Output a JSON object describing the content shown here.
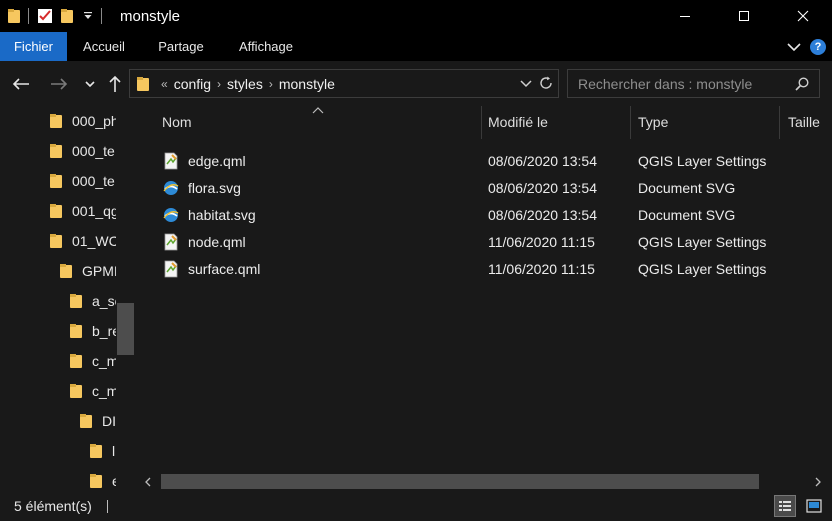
{
  "window": {
    "title": "monstyle",
    "colors": {
      "folder": "#f6c75f",
      "accent": "#1a6ac7",
      "background": "#191919",
      "titlebar": "#000000"
    }
  },
  "ribbon": {
    "tabs": [
      {
        "label": "Fichier",
        "active": true
      },
      {
        "label": "Accueil",
        "active": false
      },
      {
        "label": "Partage",
        "active": false
      },
      {
        "label": "Affichage",
        "active": false
      }
    ]
  },
  "address": {
    "overflow": "«",
    "crumbs": [
      "config",
      "styles",
      "monstyle"
    ]
  },
  "search": {
    "placeholder": "Rechercher dans : monstyle"
  },
  "tree": {
    "items": [
      {
        "label": "000_ph"
      },
      {
        "label": "000_te"
      },
      {
        "label": "000_te"
      },
      {
        "label": "001_qg"
      },
      {
        "label": "01_WC"
      },
      {
        "label": "GPMI"
      },
      {
        "label": "a_sc"
      },
      {
        "label": "b_re"
      },
      {
        "label": "c_m"
      },
      {
        "label": "c_m"
      },
      {
        "label": "DI"
      },
      {
        "label": "l"
      },
      {
        "label": "e"
      }
    ]
  },
  "list": {
    "columns": [
      {
        "label": "Nom"
      },
      {
        "label": "Modifié le"
      },
      {
        "label": "Type"
      },
      {
        "label": "Taille"
      }
    ],
    "files": [
      {
        "name": "edge.qml",
        "modified": "08/06/2020 13:54",
        "type": "QGIS Layer Settings",
        "icon": "qml-file-icon"
      },
      {
        "name": "flora.svg",
        "modified": "08/06/2020 13:54",
        "type": "Document SVG",
        "icon": "svg-file-icon"
      },
      {
        "name": "habitat.svg",
        "modified": "08/06/2020 13:54",
        "type": "Document SVG",
        "icon": "svg-file-icon"
      },
      {
        "name": "node.qml",
        "modified": "11/06/2020 11:15",
        "type": "QGIS Layer Settings",
        "icon": "qml-file-icon"
      },
      {
        "name": "surface.qml",
        "modified": "11/06/2020 11:15",
        "type": "QGIS Layer Settings",
        "icon": "qml-file-icon"
      }
    ]
  },
  "status": {
    "count": "5 élément(s)"
  }
}
